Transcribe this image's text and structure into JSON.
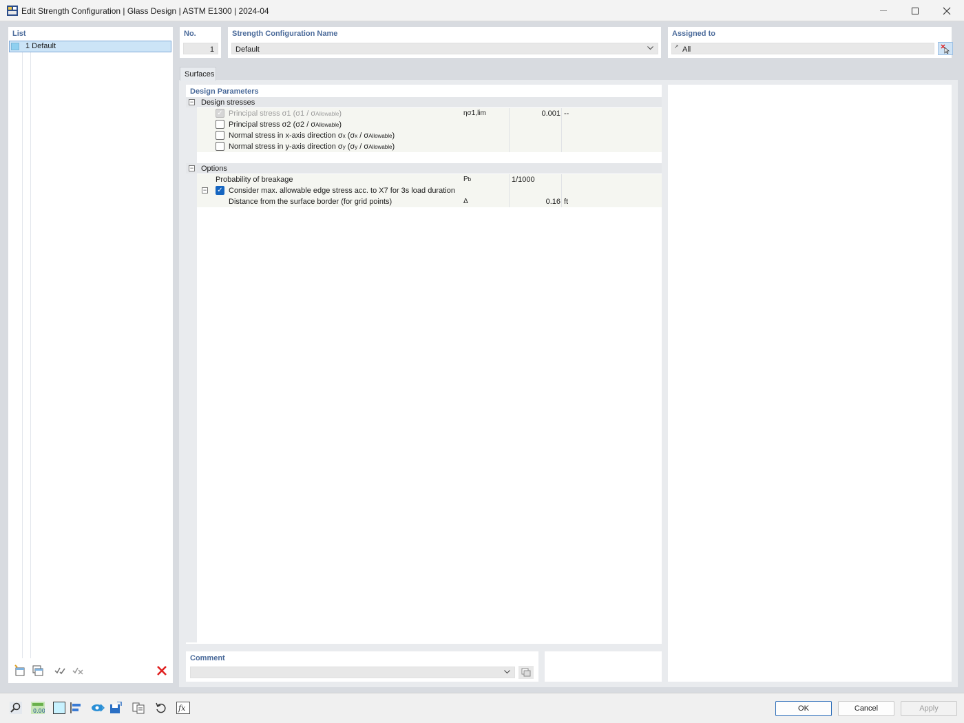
{
  "window": {
    "title": "Edit Strength Configuration | Glass Design | ASTM E1300 | 2024-04"
  },
  "list": {
    "label": "List",
    "items": [
      {
        "label": "1  Default",
        "color": "#8fd0f0"
      }
    ]
  },
  "no": {
    "label": "No.",
    "value": "1"
  },
  "config_name": {
    "label": "Strength Configuration Name",
    "value": "Default"
  },
  "assigned": {
    "label": "Assigned to",
    "value": "All"
  },
  "tabs": [
    {
      "label": "Surfaces"
    }
  ],
  "design": {
    "panel_label": "Design Parameters",
    "stresses": {
      "header": "Design stresses",
      "rows": [
        {
          "label": "Principal stress σ1 (σ1 / σAllowable)",
          "symbol": "ησ1,lim",
          "value": "0.001",
          "unit": "--",
          "checked": true,
          "disabled": true
        },
        {
          "label": "Principal stress σ2 (σ2 / σAllowable)",
          "checked": false
        },
        {
          "label": "Normal stress in x-axis direction σx (σx / σAllowable)",
          "checked": false
        },
        {
          "label": "Normal stress in y-axis direction σy (σy / σAllowable)",
          "checked": false
        }
      ]
    },
    "options": {
      "header": "Options",
      "probability": {
        "label": "Probability of breakage",
        "symbol": "Pb",
        "value": "1/1000"
      },
      "edge": {
        "label": "Consider max. allowable edge stress acc. to X7 for 3s load duration",
        "checked": true
      },
      "distance": {
        "label": "Distance from the surface border (for grid points)",
        "symbol": "Δ",
        "value": "0.16",
        "unit": "ft"
      }
    }
  },
  "comment": {
    "label": "Comment",
    "value": ""
  },
  "buttons": {
    "ok": "OK",
    "cancel": "Cancel",
    "apply": "Apply"
  },
  "colors": {
    "accent": "#1565c0",
    "label_blue": "#4a6a9a",
    "delete_red": "#e02020"
  }
}
